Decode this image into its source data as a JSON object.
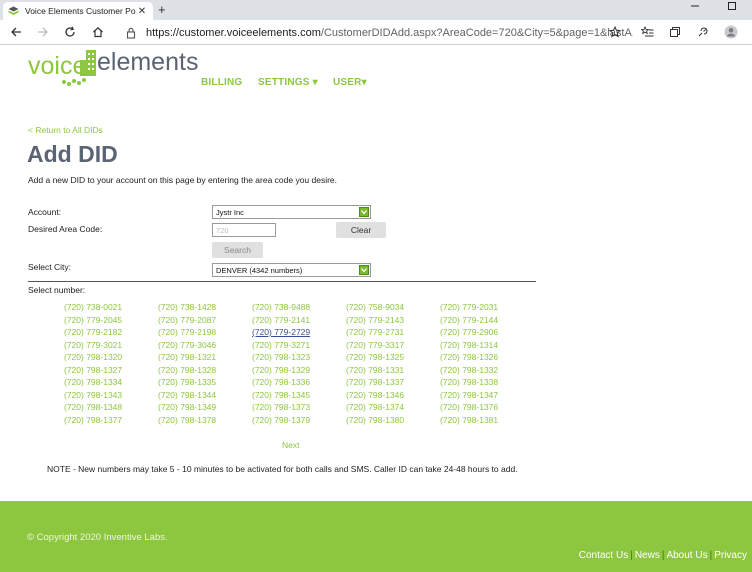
{
  "browser": {
    "tab_title": "Voice Elements Customer Portal",
    "tab_close": "✕",
    "new_tab": "+",
    "url_host": "https://customer.voiceelements.com",
    "url_path": "/CustomerDIDAdd.aspx?AreaCode=720&City=5&page=1&lastA..."
  },
  "header": {
    "logo_text_left": "voice",
    "logo_text_right": "elements",
    "nav": [
      {
        "label": "BILLING"
      },
      {
        "label": "SETTINGS ▾"
      },
      {
        "label": "USER▾"
      }
    ]
  },
  "page": {
    "return_link": "< Return to All DIDs",
    "title": "Add DID",
    "intro": "Add a new DID to your account on this page by entering the area code you desire.",
    "account_label": "Account:",
    "account_value": "Jystr Inc",
    "area_code_label": "Desired Area Code:",
    "area_code_placeholder": "720",
    "clear_button": "Clear",
    "search_button": "Search",
    "city_label": "Select City:",
    "city_value": "DENVER (4342 numbers)",
    "select_number_label": "Select number:",
    "numbers": [
      [
        "(720) 738-0021",
        "(720) 738-1428",
        "(720) 738-9488",
        "(720) 758-9034",
        "(720) 779-2031"
      ],
      [
        "(720) 779-2045",
        "(720) 779-2087",
        "(720) 779-2141",
        "(720) 779-2143",
        "(720) 779-2144"
      ],
      [
        "(720) 779-2182",
        "(720) 779-2198",
        "(720) 779-2729",
        "(720) 779-2731",
        "(720) 779-2906"
      ],
      [
        "(720) 779-3021",
        "(720) 779-3046",
        "(720) 779-3271",
        "(720) 779-3317",
        "(720) 798-1314"
      ],
      [
        "(720) 798-1320",
        "(720) 798-1321",
        "(720) 798-1323",
        "(720) 798-1325",
        "(720) 798-1326"
      ],
      [
        "(720) 798-1327",
        "(720) 798-1328",
        "(720) 798-1329",
        "(720) 798-1331",
        "(720) 798-1332"
      ],
      [
        "(720) 798-1334",
        "(720) 798-1335",
        "(720) 798-1336",
        "(720) 798-1337",
        "(720) 798-1338"
      ],
      [
        "(720) 798-1343",
        "(720) 798-1344",
        "(720) 798-1345",
        "(720) 798-1346",
        "(720) 798-1347"
      ],
      [
        "(720) 798-1348",
        "(720) 798-1349",
        "(720) 798-1373",
        "(720) 798-1374",
        "(720) 798-1376"
      ],
      [
        "(720) 798-1377",
        "(720) 798-1378",
        "(720) 798-1379",
        "(720) 798-1380",
        "(720) 798-1381"
      ]
    ],
    "next_link": "Next",
    "note": "NOTE - New numbers may take 5 - 10 minutes to be activated for both calls and SMS. Caller ID can take 24-48 hours to add."
  },
  "footer": {
    "copyright": "© Copyright 2020  Inventive Labs.",
    "links": [
      {
        "label": "Contact Us"
      },
      {
        "label": "News"
      },
      {
        "label": "About Us"
      },
      {
        "label": "Privacy"
      }
    ],
    "separator": "|"
  },
  "colors": {
    "brand_green": "#8dc63f",
    "title_slate": "#5a6473",
    "visited_link": "#3a4f8f"
  }
}
